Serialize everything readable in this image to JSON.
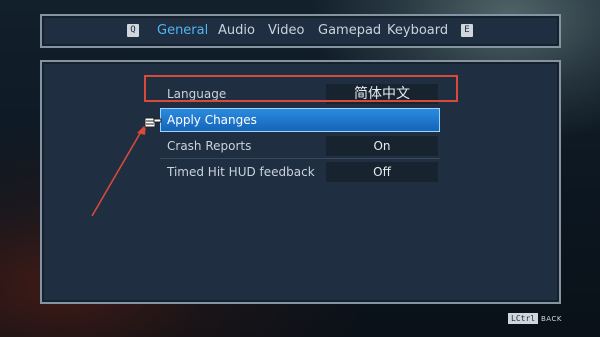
{
  "nav": {
    "left_key": "Q",
    "tabs": [
      {
        "label": "General",
        "active": true
      },
      {
        "label": "Audio"
      },
      {
        "label": "Video"
      },
      {
        "label": "Gamepad"
      },
      {
        "label": "Keyboard"
      }
    ],
    "right_key": "E"
  },
  "settings": {
    "language": {
      "label": "Language",
      "value": "简体中文"
    },
    "apply": {
      "label": "Apply Changes"
    },
    "crash_reports": {
      "label": "Crash Reports",
      "value": "On"
    },
    "timed_hit": {
      "label": "Timed Hit HUD feedback",
      "value": "Off"
    }
  },
  "footer": {
    "key": "LCtrl",
    "action": "BACK"
  },
  "colors": {
    "accent": "#4fb6f2",
    "selection": "#1e7ad0",
    "annotation": "#d84a3a"
  }
}
